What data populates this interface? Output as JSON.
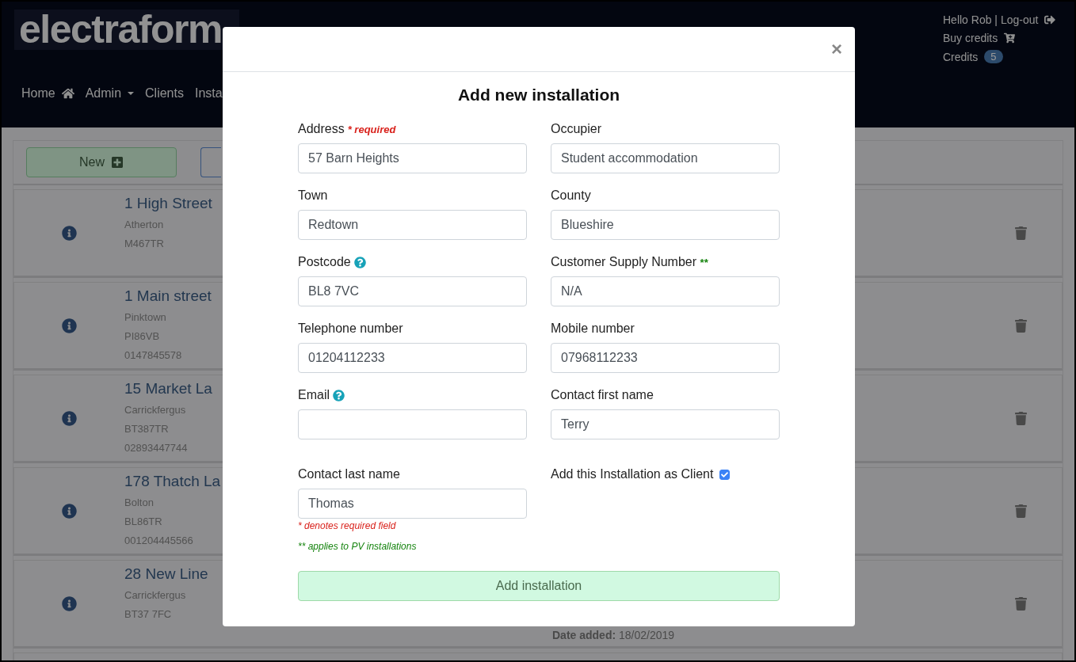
{
  "header": {
    "logo": "electraform",
    "nav": [
      {
        "label": "Home"
      },
      {
        "label": "Admin"
      },
      {
        "label": "Clients"
      },
      {
        "label": "Insta"
      }
    ],
    "user": [
      {
        "text": "Hello Rob | Log-out"
      },
      {
        "text": "Buy credits"
      },
      {
        "text": "Credits",
        "badge": "5"
      }
    ]
  },
  "toolbar": {
    "new_button": "New"
  },
  "installations": [
    {
      "title": "1 High Street",
      "lines": [
        "Atherton",
        "M467TR"
      ]
    },
    {
      "title": "1 Main street",
      "lines": [
        "Pinktown",
        "PI86VB",
        "0147845578"
      ]
    },
    {
      "title": "15 Market La",
      "lines": [
        "Carrickfergus",
        "BT387TR",
        "02893447744"
      ]
    },
    {
      "title": "178 Thatch La",
      "lines": [
        "Bolton",
        "BL86TR",
        "001204445566"
      ]
    },
    {
      "title": "28 New Line",
      "lines": [
        "Carrickfergus",
        "BT37 7FC"
      ],
      "date_added": "**Date added:** 18/02/2019"
    }
  ],
  "modal": {
    "close": "×",
    "title": "Add new installation",
    "fields": [
      {
        "kind": "text",
        "label": "Address",
        "note": {
          "text": "* required",
          "color": "#d9231d"
        },
        "value": "57 Barn Heights"
      },
      {
        "kind": "text",
        "label": "Occupier",
        "value": "Student accommodation"
      },
      {
        "kind": "text",
        "label": "Town",
        "value": "Redtown"
      },
      {
        "kind": "text",
        "label": "County",
        "value": "Blueshire"
      },
      {
        "kind": "text",
        "label": "Postcode",
        "help": true,
        "value": "BL8 7VC"
      },
      {
        "kind": "text",
        "label": "Customer Supply Number",
        "note": {
          "text": "**",
          "color": "#16840f"
        },
        "value": "N/A"
      },
      {
        "kind": "text",
        "label": "Telephone number",
        "value": "01204112233"
      },
      {
        "kind": "text",
        "label": "Mobile number",
        "value": "07968112233"
      },
      {
        "kind": "text",
        "label": "Email",
        "help": true
      },
      {
        "kind": "text",
        "label": "Contact first name",
        "value": "Terry"
      },
      {
        "kind": "text",
        "label": "Contact last name",
        "value": "Thomas"
      },
      {
        "kind": "checkbox",
        "label": "Add this Installation as Client",
        "checked": true
      }
    ],
    "footnotes": [
      {
        "text": "* denotes required field",
        "color": "#d9231d"
      },
      {
        "text": "** applies to PV installations",
        "color": "#16840f"
      }
    ],
    "submit": "Add installation"
  }
}
